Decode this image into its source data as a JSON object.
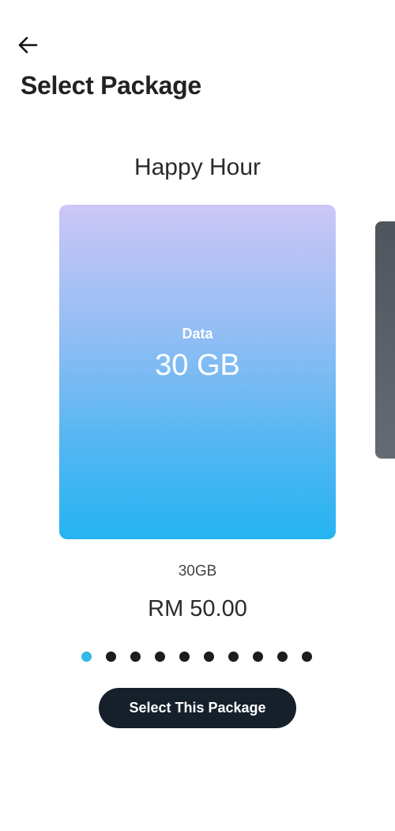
{
  "header": {
    "back_icon": "arrow-left-icon",
    "title": "Select Package"
  },
  "package": {
    "name": "Happy Hour",
    "card_label": "Data",
    "card_value": "30 GB",
    "subtitle": "30GB",
    "price": "RM 50.00"
  },
  "carousel": {
    "total": 10,
    "active_index": 0,
    "active_color": "#32b9e4",
    "inactive_color": "#1d1d1f"
  },
  "actions": {
    "select_label": "Select This Package"
  }
}
